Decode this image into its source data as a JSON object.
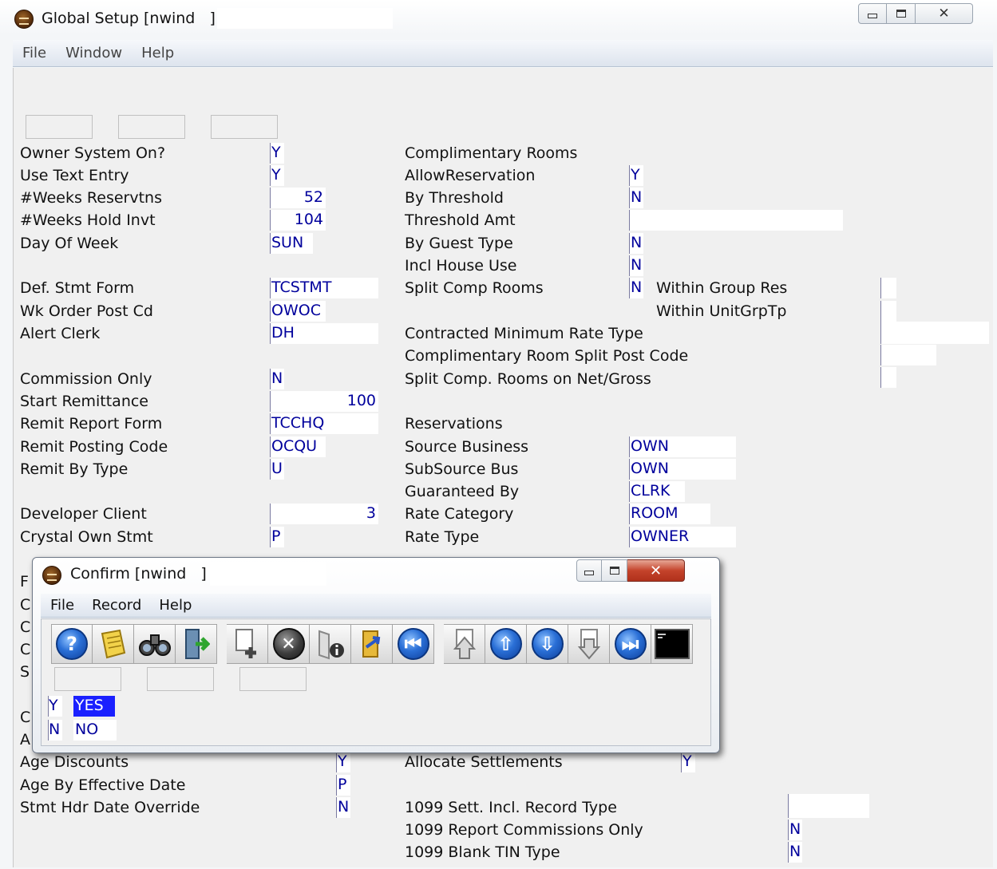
{
  "main_window": {
    "title": "Global Setup [nwind   ] -",
    "menu": [
      "File",
      "Window",
      "Help"
    ]
  },
  "left_fields": [
    {
      "label": "Owner System On?",
      "value": "Y"
    },
    {
      "label": "Use Text Entry",
      "value": "Y"
    },
    {
      "label": "#Weeks Reservtns",
      "value": "52"
    },
    {
      "label": "#Weeks Hold Invt",
      "value": "104"
    },
    {
      "label": "Day Of Week",
      "value": "SUN"
    },
    {
      "label": "Def. Stmt Form",
      "value": "TCSTMT"
    },
    {
      "label": "Wk Order Post Cd",
      "value": "OWOC"
    },
    {
      "label": "Alert Clerk",
      "value": "DH"
    },
    {
      "label": "Commission Only",
      "value": "N"
    },
    {
      "label": "Start Remittance",
      "value": "100"
    },
    {
      "label": "Remit Report Form",
      "value": "TCCHQ"
    },
    {
      "label": "Remit Posting Code",
      "value": "OCQU"
    },
    {
      "label": "Remit By Type",
      "value": "U"
    },
    {
      "label": "Developer Client",
      "value": "3"
    },
    {
      "label": "Crystal Own Stmt",
      "value": "P"
    },
    {
      "label": "Age Discounts",
      "value": "Y"
    },
    {
      "label": "Age By Effective Date",
      "value": "P"
    },
    {
      "label": "Stmt Hdr Date Override",
      "value": "N"
    }
  ],
  "left_partial_letters": [
    "F",
    "C",
    "C",
    "C",
    "S",
    "C",
    "A"
  ],
  "right_fields": [
    {
      "label": "Complimentary Rooms",
      "value": ""
    },
    {
      "label": "AllowReservation",
      "value": "Y"
    },
    {
      "label": "By Threshold",
      "value": "N"
    },
    {
      "label": "Threshold Amt",
      "value": ""
    },
    {
      "label": "By Guest Type",
      "value": "N"
    },
    {
      "label": "Incl House Use",
      "value": "N"
    },
    {
      "label": "Split Comp Rooms",
      "value": "N"
    },
    {
      "label": "Within Group Res",
      "value": ""
    },
    {
      "label": "Within UnitGrpTp",
      "value": ""
    },
    {
      "label": "Contracted Minimum Rate Type",
      "value": ""
    },
    {
      "label": "Complimentary Room Split Post Code",
      "value": ""
    },
    {
      "label": "Split Comp. Rooms on Net/Gross",
      "value": ""
    },
    {
      "label": "Reservations",
      "value": ""
    },
    {
      "label": "Source Business",
      "value": "OWN"
    },
    {
      "label": "SubSource Bus",
      "value": "OWN"
    },
    {
      "label": "Guaranteed By",
      "value": "CLRK"
    },
    {
      "label": "Rate Category",
      "value": "ROOM"
    },
    {
      "label": "Rate Type",
      "value": "OWNER"
    },
    {
      "label": "Allocate Settlements",
      "value": "Y"
    },
    {
      "label": "1099 Sett. Incl. Record Type",
      "value": ""
    },
    {
      "label": "1099 Report Commissions Only",
      "value": "N"
    },
    {
      "label": "1099 Blank TIN Type",
      "value": "N"
    }
  ],
  "confirm_window": {
    "title": "Confirm [nwind   ] -",
    "menu": [
      "File",
      "Record",
      "Help"
    ],
    "toolbar_icons": [
      "help-icon",
      "notes-icon",
      "binoculars-search-icon",
      "exit-door-icon",
      "add-record-icon",
      "delete-record-icon",
      "record-info-icon",
      "export-icon",
      "first-record-icon",
      "page-up-icon",
      "previous-record-icon",
      "next-record-icon",
      "page-down-icon",
      "last-record-icon",
      "console-icon"
    ],
    "options": [
      {
        "code": "Y",
        "text": "YES"
      },
      {
        "code": "N",
        "text": "NO"
      }
    ]
  },
  "colors": {
    "field_text": "#00009c",
    "selected_bg": "#1a20ff",
    "close_button": "#c4432b"
  }
}
